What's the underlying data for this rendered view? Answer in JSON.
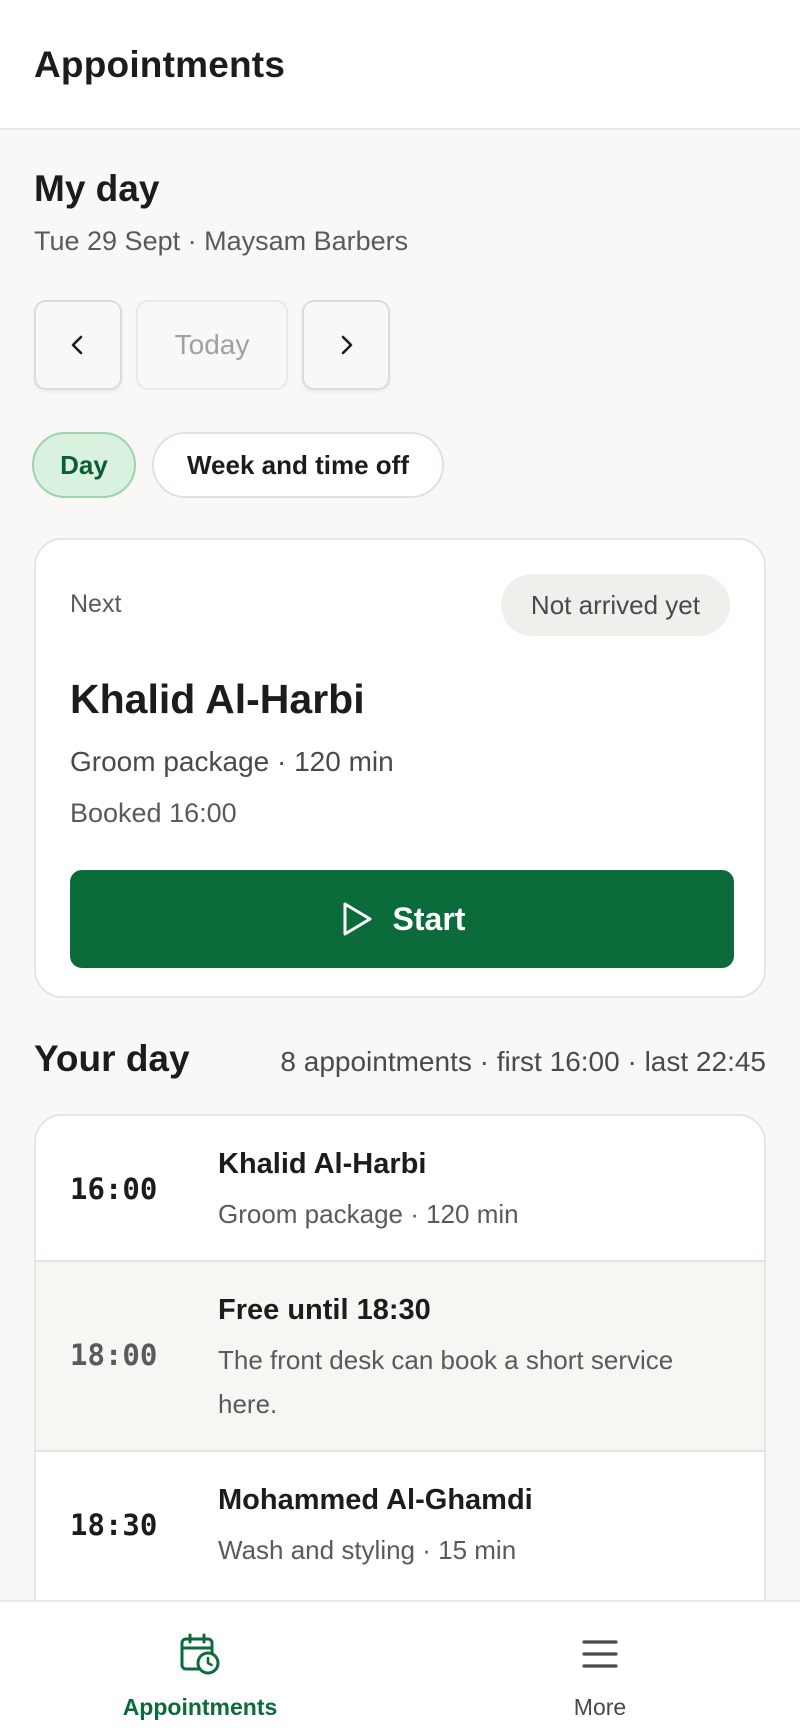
{
  "header": {
    "title": "Appointments"
  },
  "my_day": {
    "title": "My day",
    "subtitle": "Tue 29 Sept · Maysam Barbers",
    "today_label": "Today",
    "prev_icon": "chevron-left-icon",
    "next_icon": "chevron-right-icon"
  },
  "view_tabs": [
    {
      "label": "Day",
      "selected": true
    },
    {
      "label": "Week and time off",
      "selected": false
    }
  ],
  "next_card": {
    "label": "Next",
    "status": "Not arrived yet",
    "client": "Khalid Al-Harbi",
    "service": "Groom package · 120 min",
    "booked": "Booked 16:00",
    "start_label": "Start",
    "start_icon": "play-icon",
    "accent": "#0b6b3a"
  },
  "your_day": {
    "title": "Your day",
    "summary": "8 appointments · first 16:00 · last 22:45",
    "rows": [
      {
        "time": "16:00",
        "title": "Khalid Al-Harbi",
        "desc": "Groom package · 120 min",
        "free": false
      },
      {
        "time": "18:00",
        "title": "Free until 18:30",
        "desc": "The front desk can book a short service here.",
        "free": true
      },
      {
        "time": "18:30",
        "title": "Mohammed Al-Ghamdi",
        "desc": "Wash and styling · 15 min",
        "free": false
      }
    ]
  },
  "bottom_nav": [
    {
      "label": "Appointments",
      "icon": "calendar-clock-icon",
      "active": true
    },
    {
      "label": "More",
      "icon": "menu-icon",
      "active": false
    }
  ]
}
